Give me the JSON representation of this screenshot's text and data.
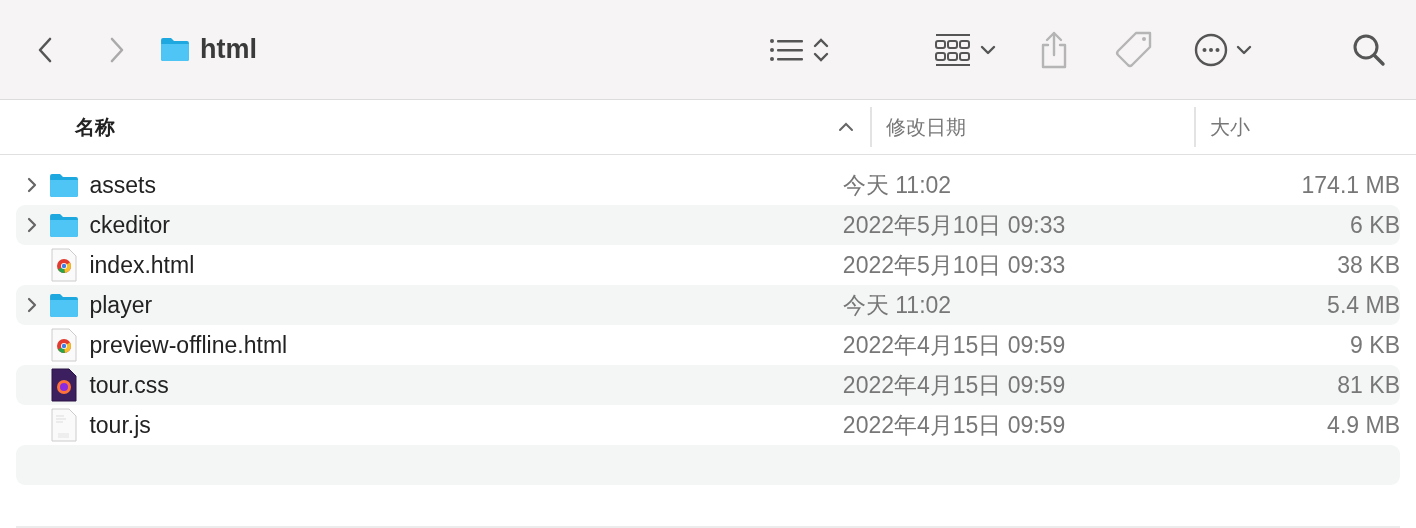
{
  "toolbar": {
    "title": "html"
  },
  "columns": [
    {
      "label": "名称",
      "sorted": true
    },
    {
      "label": "修改日期",
      "sorted": false
    },
    {
      "label": "大小",
      "sorted": false
    }
  ],
  "rows": [
    {
      "kind": "folder",
      "name": "assets",
      "date": "今天 11:02",
      "size": "174.1 MB",
      "expanded": false
    },
    {
      "kind": "folder",
      "name": "ckeditor",
      "date": "2022年5月10日 09:33",
      "size": "6 KB",
      "expanded": false
    },
    {
      "kind": "chrome",
      "name": "index.html",
      "date": "2022年5月10日 09:33",
      "size": "38 KB"
    },
    {
      "kind": "folder",
      "name": "player",
      "date": "今天 11:02",
      "size": "5.4 MB",
      "expanded": false
    },
    {
      "kind": "chrome",
      "name": "preview-offline.html",
      "date": "2022年4月15日 09:59",
      "size": "9 KB"
    },
    {
      "kind": "firefox",
      "name": "tour.css",
      "date": "2022年4月15日 09:59",
      "size": "81 KB"
    },
    {
      "kind": "script",
      "name": "tour.js",
      "date": "2022年4月15日 09:59",
      "size": "4.9 MB"
    }
  ]
}
